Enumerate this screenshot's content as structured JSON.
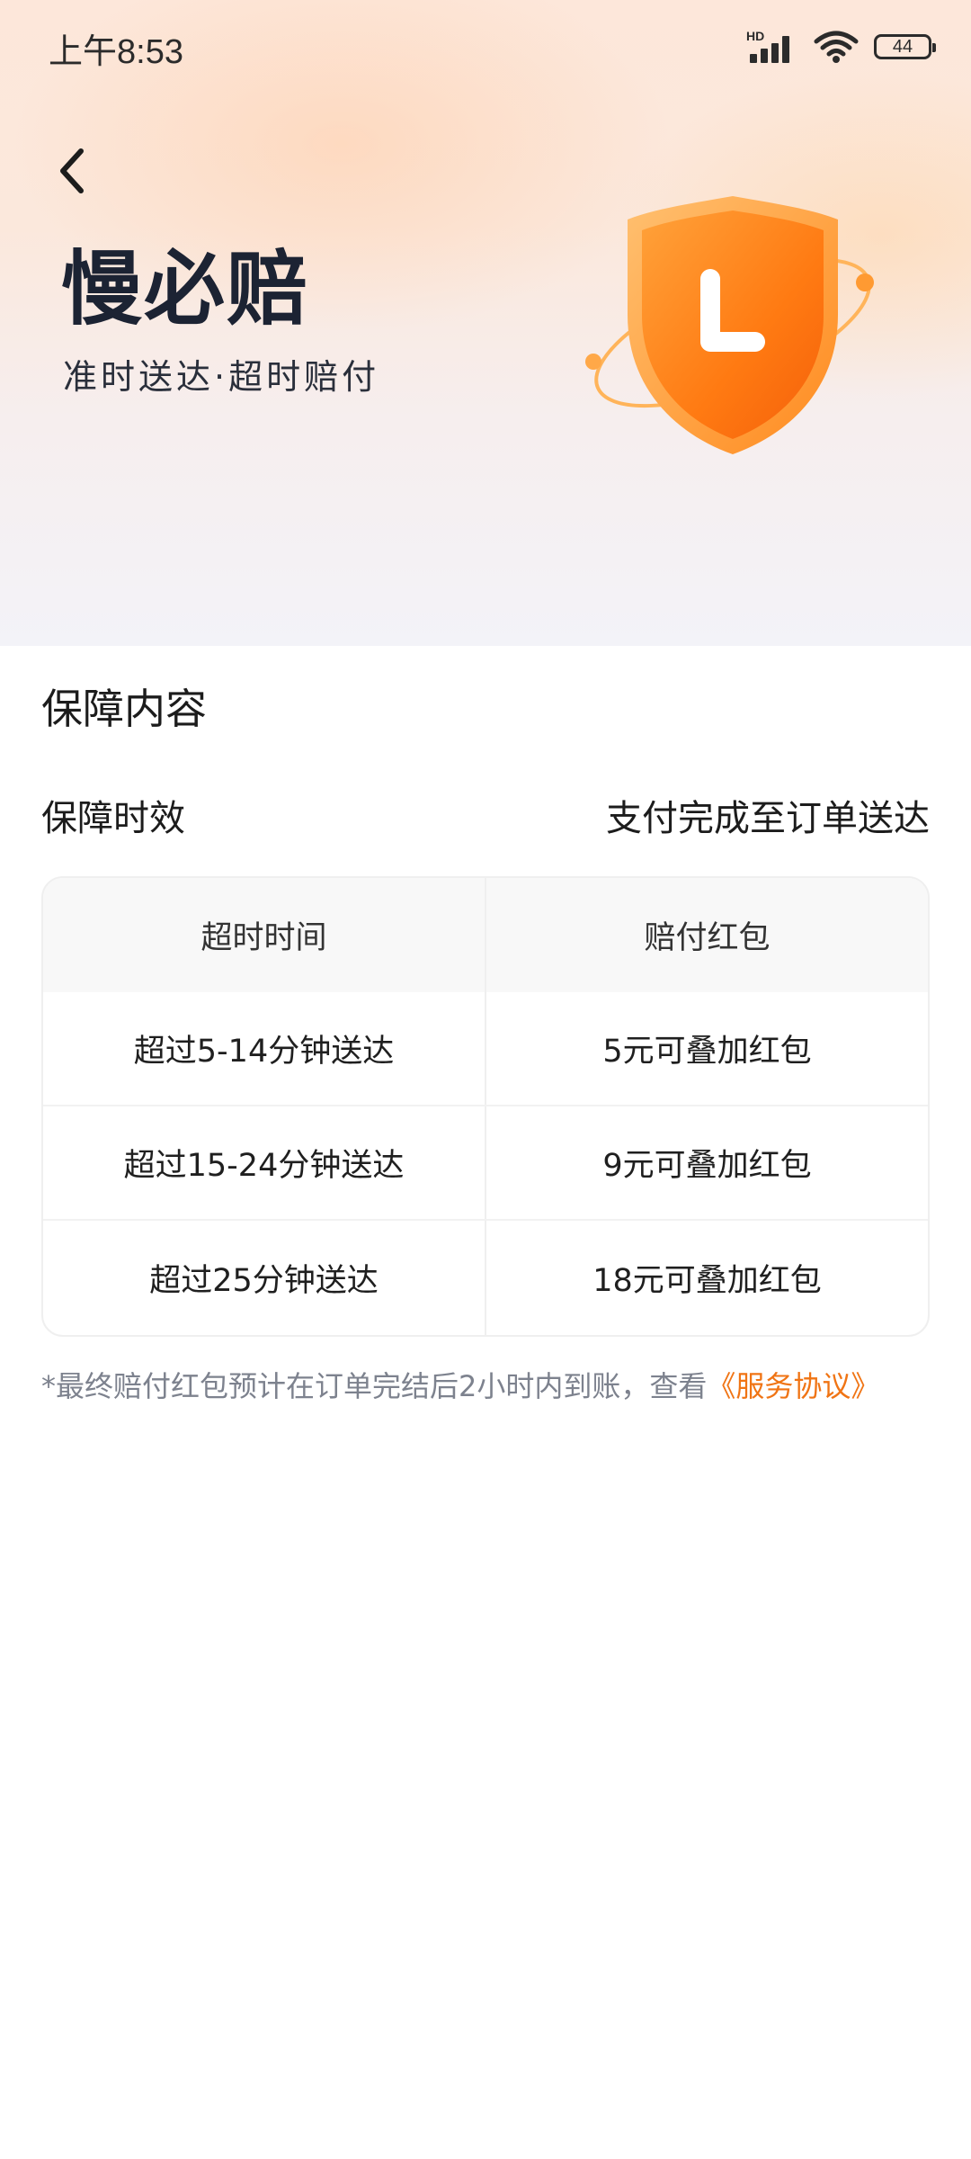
{
  "status_bar": {
    "time": "上午8:53",
    "network_label": "HD",
    "battery_level": "44"
  },
  "header": {
    "title": "慢必赔",
    "subtitle": "准时送达·超时赔付",
    "shield_letter": "L"
  },
  "section": {
    "title": "保障内容"
  },
  "period": {
    "label": "保障时效",
    "value": "支付完成至订单送达"
  },
  "table": {
    "headers": [
      "超时时间",
      "赔付红包"
    ],
    "rows": [
      [
        "超过5-14分钟送达",
        "5元可叠加红包"
      ],
      [
        "超过15-24分钟送达",
        "9元可叠加红包"
      ],
      [
        "超过25分钟送达",
        "18元可叠加红包"
      ]
    ]
  },
  "footnote": {
    "text": "*最终赔付红包预计在订单完结后2小时内到账，查看",
    "link_text": "《服务协议》"
  },
  "colors": {
    "accent": "#f07414",
    "title": "#1c2333",
    "muted": "#7d828e"
  }
}
